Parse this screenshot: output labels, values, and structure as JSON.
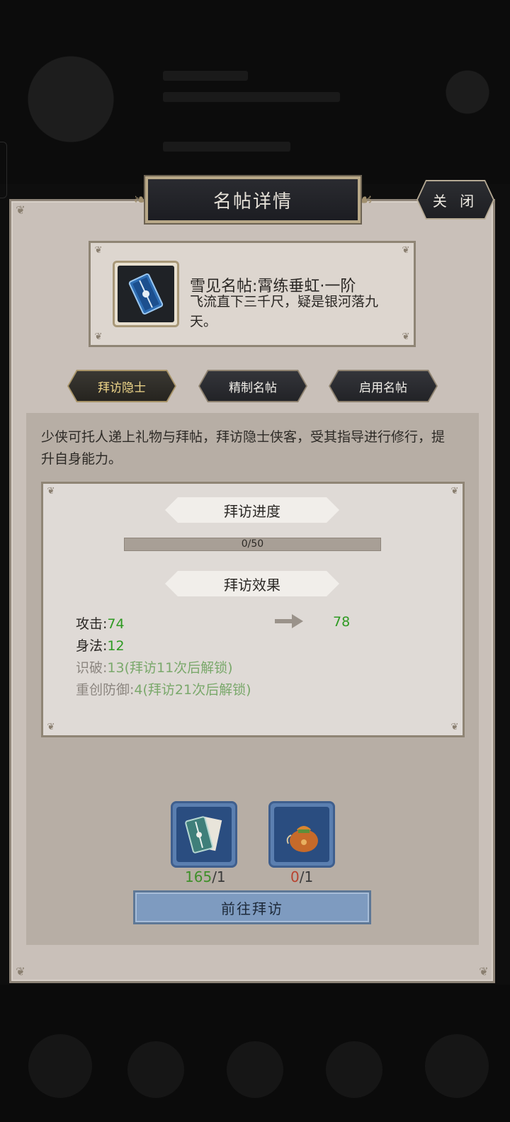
{
  "modal": {
    "title": "名帖详情",
    "close_label": "关 闭"
  },
  "item": {
    "name": "雪见名帖:霄练垂虹·一阶",
    "description": "飞流直下三千尺，疑是银河落九天。"
  },
  "tabs": [
    {
      "label": "拜访隐士",
      "active": true
    },
    {
      "label": "精制名帖",
      "active": false
    },
    {
      "label": "启用名帖",
      "active": false
    }
  ],
  "intro_text": "少侠可托人递上礼物与拜帖，拜访隐士侠客，受其指导进行修行，提升自身能力。",
  "progress": {
    "heading": "拜访进度",
    "current": 0,
    "max": 50,
    "text": "0/50"
  },
  "effects": {
    "heading": "拜访效果",
    "stats": [
      {
        "key": "攻击:",
        "value": "74",
        "next": "78",
        "locked": false
      },
      {
        "key": "身法:",
        "value": "12",
        "locked": false
      },
      {
        "key": "识破:",
        "value": "13(拜访11次后解锁)",
        "locked": true
      },
      {
        "key": "重创防御:",
        "value": "4(拜访21次后解锁)",
        "locked": true
      }
    ]
  },
  "costs": [
    {
      "icon": "card-scroll-icon",
      "have": "165",
      "need": "/1",
      "sufficient": true
    },
    {
      "icon": "gift-pouch-icon",
      "have": "0",
      "need": "/1",
      "sufficient": false
    }
  ],
  "action_label": "前往拜访",
  "colors": {
    "green": "#2e9a22",
    "red": "#b8432f",
    "active_tab_text": "#f0d78a"
  }
}
